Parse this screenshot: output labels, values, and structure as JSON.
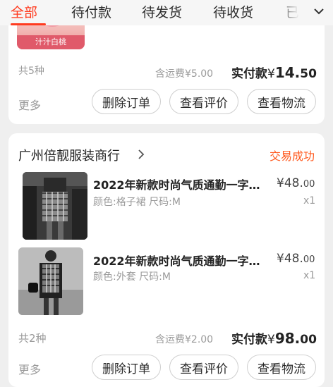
{
  "tabs": [
    "全部",
    "待付款",
    "待发货",
    "待收货",
    "已l"
  ],
  "orders": [
    {
      "thumb_label": "汁汁白桃",
      "count": "共5种",
      "shipping_label": "含运费",
      "shipping_amount": "¥5.00",
      "paid_label": "实付款",
      "paid_currency": "¥",
      "paid_int": "14.",
      "paid_dec": "50",
      "more": "更多",
      "buttons": [
        "删除订单",
        "查看评价",
        "查看物流"
      ]
    },
    {
      "shop": "广州倍靓服装商行",
      "status": "交易成功",
      "items": [
        {
          "title": "2022年新款时尚气质通勤一字…",
          "spec": "颜色:格子裙  尺码:M",
          "price_int": "¥48.",
          "price_dec": "00",
          "qty": "x1"
        },
        {
          "title": "2022年新款时尚气质通勤一字…",
          "spec": "颜色:外套  尺码:M",
          "price_int": "¥48.",
          "price_dec": "00",
          "qty": "x1"
        }
      ],
      "count": "共2种",
      "shipping_label": "含运费",
      "shipping_amount": "¥2.00",
      "paid_label": "实付款",
      "paid_currency": "¥",
      "paid_int": "98.",
      "paid_dec": "00",
      "more": "更多",
      "buttons": [
        "删除订单",
        "查看评价",
        "查看物流"
      ]
    }
  ],
  "colors": {
    "accent": "#ff3b1f",
    "status": "#ff5a1f"
  }
}
